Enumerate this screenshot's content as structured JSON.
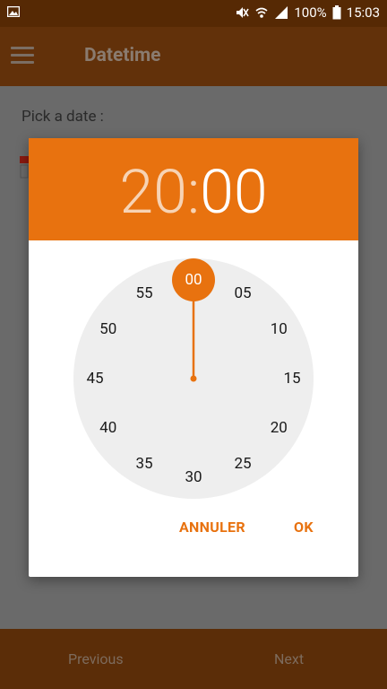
{
  "status_bar": {
    "battery": "100%",
    "time": "15:03",
    "icons": [
      "image-icon",
      "mute-icon",
      "wifi-icon",
      "signal-icon",
      "battery-icon"
    ]
  },
  "app_bar": {
    "title": "Datetime",
    "menu_icon": "menu-icon"
  },
  "content": {
    "date_label": "Pick a date :",
    "calendar_icon": "calendar-icon"
  },
  "dialog": {
    "time": {
      "hours": "20",
      "separator": ":",
      "minutes": "00"
    },
    "clock_face": {
      "selected": "00",
      "numbers": [
        "00",
        "05",
        "10",
        "15",
        "20",
        "25",
        "30",
        "35",
        "40",
        "45",
        "50",
        "55"
      ]
    },
    "actions": {
      "cancel_label": "ANNULER",
      "ok_label": "OK"
    }
  },
  "bottom_nav": {
    "previous_label": "Previous",
    "next_label": "Next"
  },
  "colors": {
    "accent": "#e8720f",
    "status_bar": "#562904",
    "app_bar": "#62310a",
    "clock_face": "#eeeeee"
  }
}
